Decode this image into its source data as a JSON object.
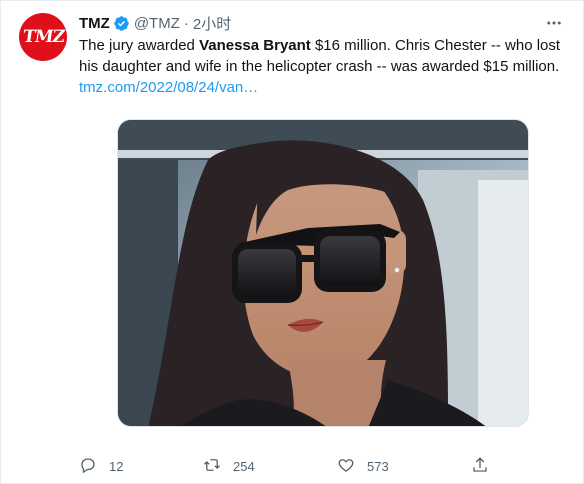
{
  "tweet": {
    "avatar": {
      "logo_text": "TMZ",
      "color": "#e0101b"
    },
    "display_name": "TMZ",
    "handle": "@TMZ",
    "separator": "·",
    "time": "2小时",
    "text": {
      "part1": "The jury awarded ",
      "bold": "Vanessa Bryant",
      "part2": " $16 million. Chris Chester -- who lost his daughter and wife in the helicopter crash -- was awarded $15 million."
    },
    "link": "tmz.com/2022/08/24/van…",
    "image_alt": "Photo of a woman with dark hair wearing dark sunglasses",
    "actions": {
      "reply": {
        "icon": "reply-icon",
        "count": "12"
      },
      "retweet": {
        "icon": "retweet-icon",
        "count": "254"
      },
      "like": {
        "icon": "heart-icon",
        "count": "573"
      },
      "share": {
        "icon": "share-icon"
      }
    },
    "colors": {
      "link": "#1d9bf0",
      "verified": "#1d9bf0",
      "muted": "#536471"
    }
  }
}
